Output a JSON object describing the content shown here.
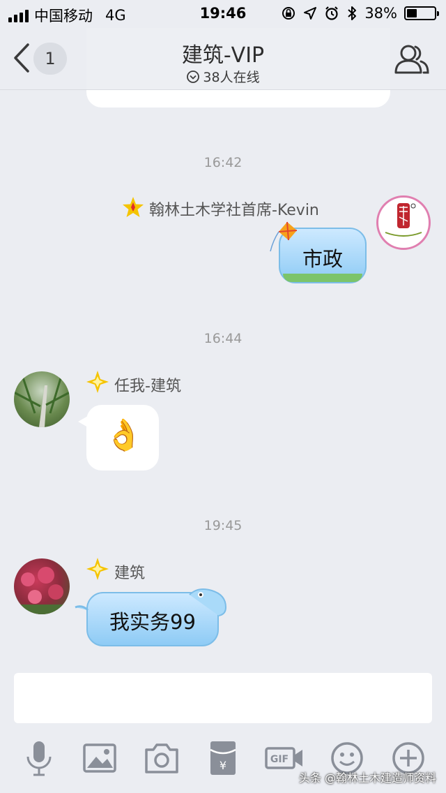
{
  "status_bar": {
    "carrier": "中国移动",
    "network": "4G",
    "time": "19:46",
    "battery": "38%",
    "battery_level": 0.38
  },
  "nav": {
    "unread_count": "1",
    "title": "建筑-VIP",
    "online": "38人在线"
  },
  "messages": [
    {
      "timestamp": "16:42",
      "sender": "翰林土木学社首席-Kevin",
      "text": "市政",
      "side": "right",
      "avatar_text": "土木学社"
    },
    {
      "timestamp": "16:44",
      "sender": "任我-建筑",
      "text": "👌",
      "side": "left"
    },
    {
      "timestamp": "19:45",
      "sender": "建筑",
      "text": "我实务99",
      "side": "left"
    }
  ],
  "watermark": "头条 @翰林土木建造师资料",
  "colors": {
    "background": "#ebedf2",
    "bubble_blue": "#a9daf9",
    "badge_gold": "#f5c400",
    "icon_gray": "#8a8f99"
  },
  "toolbar_icons": [
    "microphone-icon",
    "image-icon",
    "camera-icon",
    "red-packet-icon",
    "gif-icon",
    "emoji-icon",
    "plus-icon"
  ]
}
